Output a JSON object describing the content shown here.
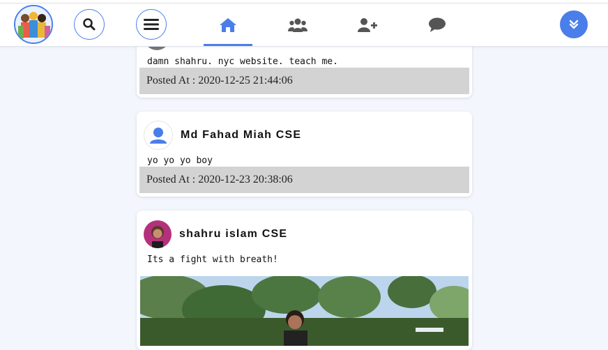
{
  "nav": {
    "logo_icon": "people-group-logo",
    "search_icon": "search-icon",
    "menu_icon": "hamburger-menu-icon",
    "tabs": [
      {
        "icon": "home-icon",
        "active": true
      },
      {
        "icon": "users-icon",
        "active": false
      },
      {
        "icon": "user-plus-icon",
        "active": false
      },
      {
        "icon": "chat-icon",
        "active": false
      }
    ],
    "dropdown_icon": "double-chevron-down-icon",
    "accent": "#4a7ee8"
  },
  "posts": [
    {
      "author": "",
      "text": "damn shahru. nyc website. teach me.",
      "posted": "Posted At : 2020-12-25 21:44:06"
    },
    {
      "author": "Md Fahad Miah CSE",
      "text": "yo yo yo boy",
      "posted": "Posted At : 2020-12-23 20:38:06"
    },
    {
      "author": "shahru islam CSE",
      "text": "Its a fight with breath!",
      "photo": "outdoor-photo"
    }
  ]
}
